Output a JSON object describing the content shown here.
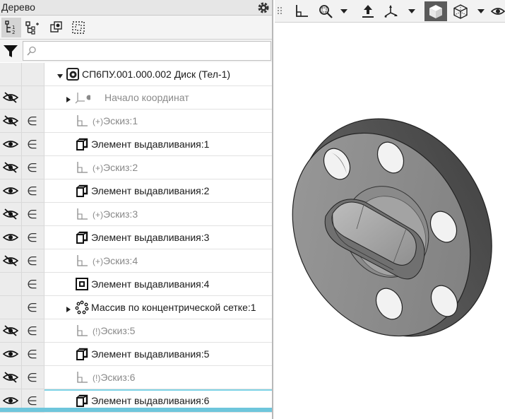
{
  "panel": {
    "title": "Дерево",
    "search": {
      "value": "",
      "placeholder": ""
    }
  },
  "tree": {
    "root_label": "СП6ПУ.001.000.002 Диск (Тел-1)",
    "rows": [
      {
        "label": "Начало координат",
        "prefix": "",
        "icon": "axis-origin-icon",
        "dim": true,
        "visible": false
      },
      {
        "label": "Эскиз:1",
        "prefix": "(+)",
        "icon": "sketch-icon",
        "dim": true,
        "visible": false
      },
      {
        "label": "Элемент выдавливания:1",
        "prefix": "",
        "icon": "extrude-icon",
        "dim": false,
        "visible": true
      },
      {
        "label": "Эскиз:2",
        "prefix": "(+)",
        "icon": "sketch-icon",
        "dim": true,
        "visible": false
      },
      {
        "label": "Элемент выдавливания:2",
        "prefix": "",
        "icon": "extrude-icon",
        "dim": false,
        "visible": true
      },
      {
        "label": "Эскиз:3",
        "prefix": "(+)",
        "icon": "sketch-icon",
        "dim": true,
        "visible": false
      },
      {
        "label": "Элемент выдавливания:3",
        "prefix": "",
        "icon": "extrude-icon",
        "dim": false,
        "visible": true
      },
      {
        "label": "Эскиз:4",
        "prefix": "(+)",
        "icon": "sketch-icon",
        "dim": true,
        "visible": false
      },
      {
        "label": "Элемент выдавливания:4",
        "prefix": "",
        "icon": "extrude-cut-icon",
        "dim": false,
        "visible": null
      },
      {
        "label": "Массив по концентрической сетке:1",
        "prefix": "",
        "icon": "circular-pattern-icon",
        "dim": false,
        "visible": null
      },
      {
        "label": "Эскиз:5",
        "prefix": "(!)",
        "icon": "sketch-icon",
        "dim": true,
        "visible": false
      },
      {
        "label": "Элемент выдавливания:5",
        "prefix": "",
        "icon": "extrude-icon",
        "dim": false,
        "visible": true
      },
      {
        "label": "Эскиз:6",
        "prefix": "(!)",
        "icon": "sketch-icon",
        "dim": true,
        "visible": false
      },
      {
        "label": "Элемент выдавливания:6",
        "prefix": "",
        "icon": "extrude-icon",
        "dim": false,
        "visible": true
      }
    ],
    "inclusion_symbol": "∈"
  },
  "colors": {
    "accent": "#6ec6dc",
    "model_face": "#8c8c8c",
    "model_dark": "#4a4a4a"
  }
}
